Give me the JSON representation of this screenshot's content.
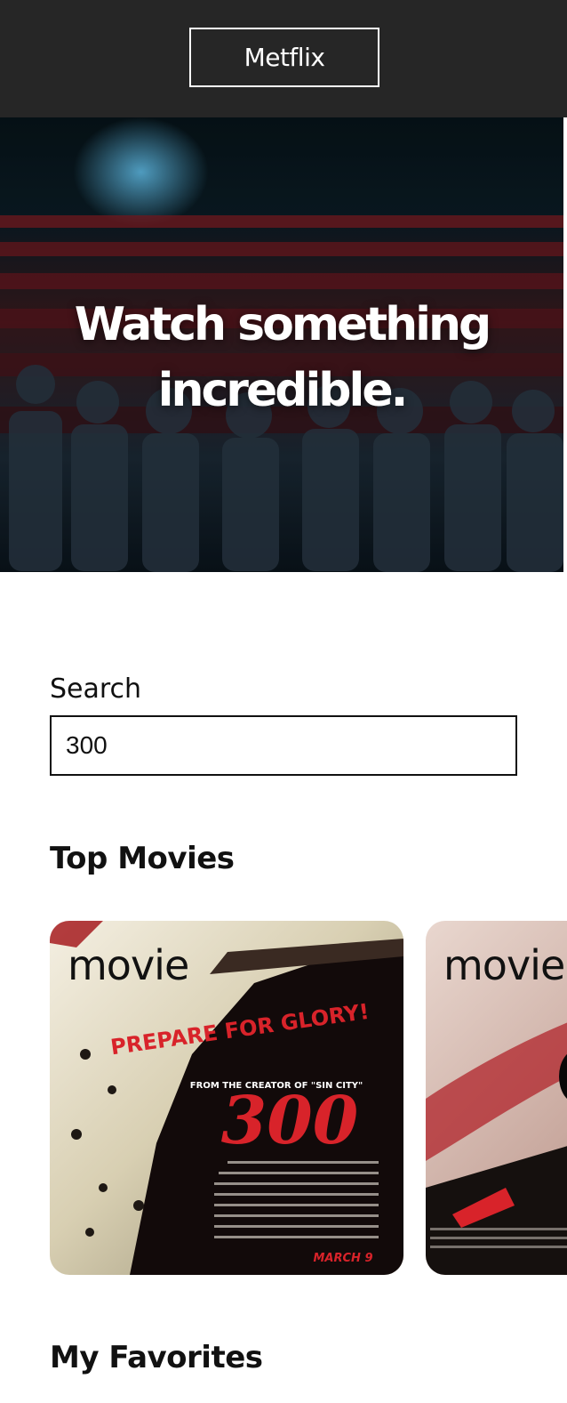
{
  "header": {
    "brand": "Metflix"
  },
  "hero": {
    "title": "Watch something incredible."
  },
  "search": {
    "label": "Search",
    "value": "300"
  },
  "sections": {
    "top_movies": "Top Movies",
    "favorites": "My Favorites"
  },
  "movies": [
    {
      "label": "movie",
      "poster": {
        "tagline": "PREPARE FOR GLORY!",
        "creator_line": "FROM THE CREATOR OF \"SIN CITY\"",
        "title": "300",
        "release": "MARCH 9"
      }
    },
    {
      "label": "movie"
    }
  ],
  "colors": {
    "header_bg": "#262626",
    "poster_red": "#d8232a"
  }
}
